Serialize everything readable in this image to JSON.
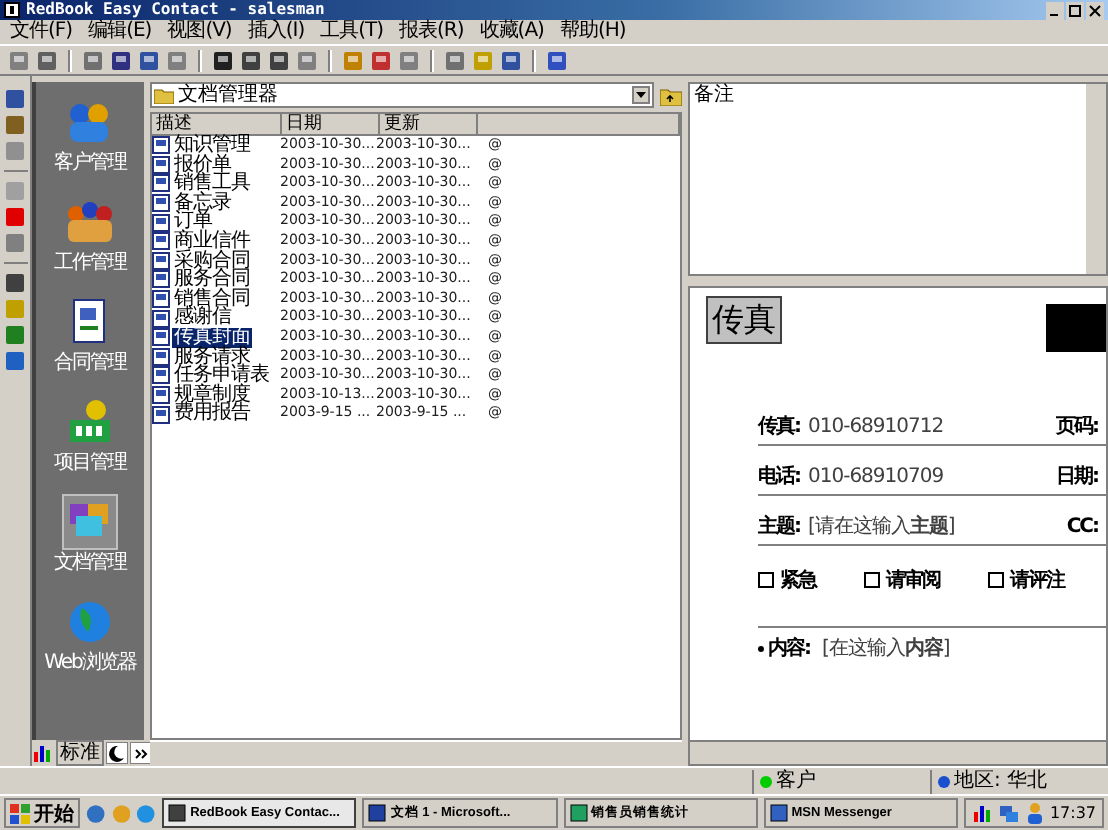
{
  "window": {
    "title": "RedBook Easy Contact - salesman"
  },
  "menu": [
    "文件(F)",
    "编辑(E)",
    "视图(V)",
    "插入(I)",
    "工具(T)",
    "报表(R)",
    "收藏(A)",
    "帮助(H)"
  ],
  "sidebar": {
    "items": [
      {
        "label": "客户管理",
        "selected": false
      },
      {
        "label": "工作管理",
        "selected": false
      },
      {
        "label": "合同管理",
        "selected": false
      },
      {
        "label": "项目管理",
        "selected": false
      },
      {
        "label": "文档管理",
        "selected": true
      },
      {
        "label": "Web浏览器",
        "selected": false
      }
    ],
    "tab": "标准"
  },
  "file_panel": {
    "path": "文档管理器",
    "columns": [
      "描述",
      "日期",
      "更新"
    ],
    "rows": [
      {
        "name": "知识管理",
        "date": "2003-10-30...",
        "updated": "2003-10-30...",
        "column_4": "@",
        "selected": false
      },
      {
        "name": "报价单",
        "date": "2003-10-30...",
        "updated": "2003-10-30...",
        "column_4": "@",
        "selected": false
      },
      {
        "name": "销售工具",
        "date": "2003-10-30...",
        "updated": "2003-10-30...",
        "column_4": "@",
        "selected": false
      },
      {
        "name": "备忘录",
        "date": "2003-10-30...",
        "updated": "2003-10-30...",
        "column_4": "@",
        "selected": false
      },
      {
        "name": "订单",
        "date": "2003-10-30...",
        "updated": "2003-10-30...",
        "column_4": "@",
        "selected": false
      },
      {
        "name": "商业信件",
        "date": "2003-10-30...",
        "updated": "2003-10-30...",
        "column_4": "@",
        "selected": false
      },
      {
        "name": "采购合同",
        "date": "2003-10-30...",
        "updated": "2003-10-30...",
        "column_4": "@",
        "selected": false
      },
      {
        "name": "服务合同",
        "date": "2003-10-30...",
        "updated": "2003-10-30...",
        "column_4": "@",
        "selected": false
      },
      {
        "name": "销售合同",
        "date": "2003-10-30...",
        "updated": "2003-10-30...",
        "column_4": "@",
        "selected": false
      },
      {
        "name": "感谢信",
        "date": "2003-10-30...",
        "updated": "2003-10-30...",
        "column_4": "@",
        "selected": false
      },
      {
        "name": "传真封面",
        "date": "2003-10-30...",
        "updated": "2003-10-30...",
        "column_4": "@",
        "selected": true
      },
      {
        "name": "服务请求",
        "date": "2003-10-30...",
        "updated": "2003-10-30...",
        "column_4": "@",
        "selected": false
      },
      {
        "name": "任务申请表",
        "date": "2003-10-30...",
        "updated": "2003-10-30...",
        "column_4": "@",
        "selected": false
      },
      {
        "name": "规章制度",
        "date": "2003-10-13...",
        "updated": "2003-10-30...",
        "column_4": "@",
        "selected": false
      },
      {
        "name": "费用报告",
        "date": "2003-9-15 ...",
        "updated": "2003-9-15 ...",
        "column_4": "@",
        "selected": false
      }
    ]
  },
  "memo": {
    "label": "备注"
  },
  "fax": {
    "title": "传真",
    "fields": [
      {
        "label": "传真:",
        "value": "010-68910712",
        "side_label": "页码:"
      },
      {
        "label": "电话:",
        "value": "010-68910709",
        "side_label": "日期:"
      },
      {
        "label": "主题:",
        "value": "[请在这输入**主题**]",
        "side_label": "CC:"
      }
    ],
    "checkboxes": [
      {
        "label": "紧急",
        "checked": false
      },
      {
        "label": "请审阅",
        "checked": false
      },
      {
        "label": "请评注",
        "checked": false
      }
    ],
    "content": {
      "label": "内容:",
      "value": "[在这输入**内容**]"
    }
  },
  "status_bar": [
    {
      "text": "客户",
      "color": "#00cc00"
    },
    {
      "text": "地区: 华北",
      "color": "#1a4fd0"
    }
  ],
  "taskbar": {
    "start": "开始",
    "tasks": [
      "RedBook Easy Contac...",
      "文档 1 - Microsoft...",
      "销售员销售统计",
      "MSN Messenger"
    ],
    "clock": "17:37"
  }
}
